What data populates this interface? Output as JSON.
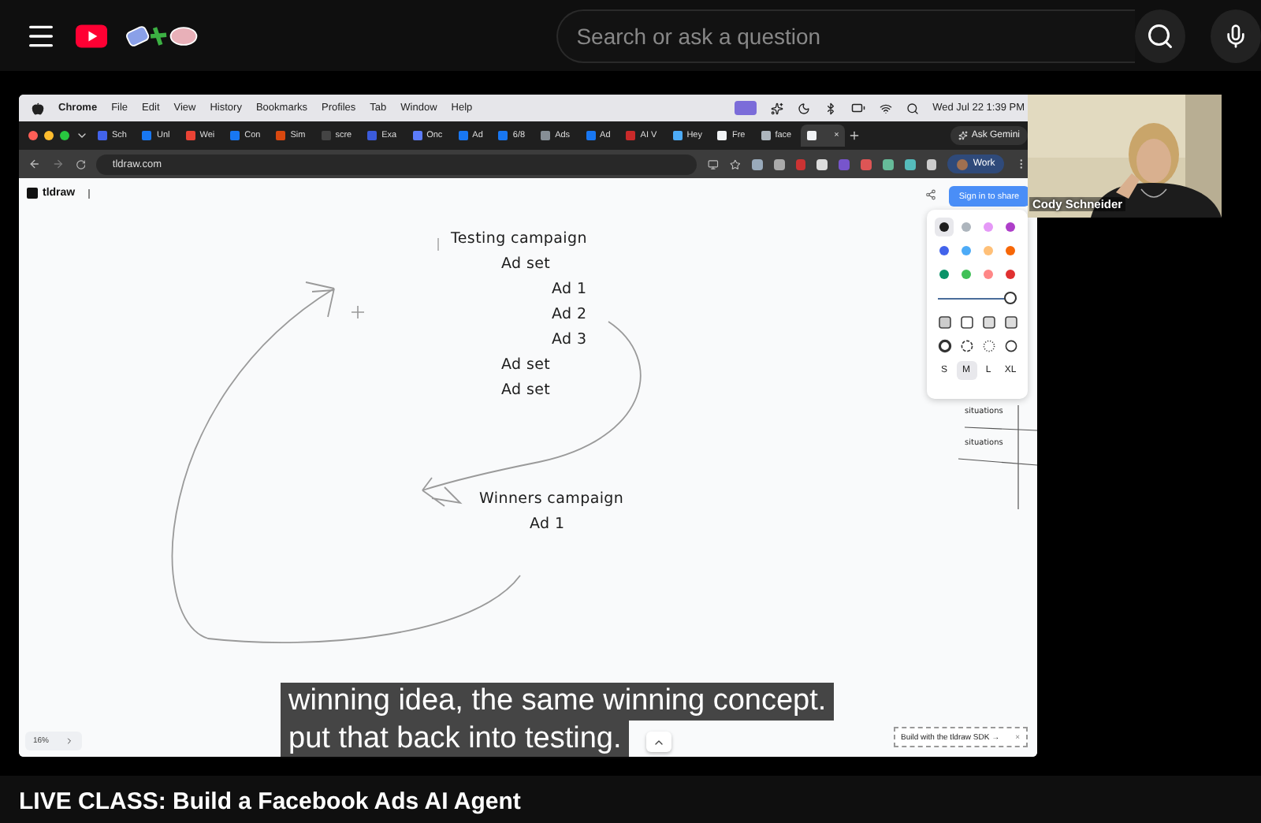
{
  "header": {
    "search": {
      "placeholder": "Search or ask a question"
    }
  },
  "screen": {
    "menu_bar": {
      "app": "Chrome",
      "items": [
        "File",
        "Edit",
        "View",
        "History",
        "Bookmarks",
        "Profiles",
        "Tab",
        "Window",
        "Help"
      ],
      "clock": "Wed Jul 22  1:39 PM"
    },
    "tabs": [
      {
        "label": "Sch",
        "color": "#4263eb",
        "selected": false
      },
      {
        "label": "Unl",
        "color": "#1877f2",
        "selected": false
      },
      {
        "label": "Wei",
        "color": "#ea4335",
        "selected": false
      },
      {
        "label": "Con",
        "color": "#1877f2",
        "selected": false
      },
      {
        "label": "Sim",
        "color": "#d9480f",
        "selected": false
      },
      {
        "label": "scre",
        "color": "#444444",
        "selected": false
      },
      {
        "label": "Exa",
        "color": "#3b5bdb",
        "selected": false
      },
      {
        "label": "Onc",
        "color": "#5c7cfa",
        "selected": false
      },
      {
        "label": "Ad",
        "color": "#1877f2",
        "selected": false
      },
      {
        "label": "6/8",
        "color": "#1877f2",
        "selected": false
      },
      {
        "label": "Ads",
        "color": "#868e96",
        "selected": false
      },
      {
        "label": "Ad",
        "color": "#1877f2",
        "selected": false
      },
      {
        "label": "AI V",
        "color": "#c92a2a",
        "selected": false
      },
      {
        "label": "Hey",
        "color": "#4dabf7",
        "selected": false
      },
      {
        "label": "Fre",
        "color": "#f1f3f5",
        "selected": false
      },
      {
        "label": "face",
        "color": "#adb5bd",
        "selected": false
      },
      {
        "color": "#f1f3f5",
        "selected": true,
        "close": "×"
      }
    ],
    "ask_gemini": "Ask Gemini",
    "address": "tldraw.com",
    "profile": "Work",
    "canvas": {
      "logo": "tldraw",
      "sign_in": "Sign in to share",
      "colors": [
        {
          "color": "#1d1d1d",
          "selected": true
        },
        {
          "color": "#adb5bd",
          "selected": false
        },
        {
          "color": "#e599f7",
          "selected": false
        },
        {
          "color": "#ae3ec9",
          "selected": false
        },
        {
          "color": "#4263eb",
          "selected": false
        },
        {
          "color": "#4dabf7",
          "selected": false
        },
        {
          "color": "#ffc078",
          "selected": false
        },
        {
          "color": "#f76707",
          "selected": false
        },
        {
          "color": "#099268",
          "selected": false
        },
        {
          "color": "#40c057",
          "selected": false
        },
        {
          "color": "#ff8787",
          "selected": false
        },
        {
          "color": "#e03131",
          "selected": false
        }
      ],
      "opacity": {
        "level": 1
      },
      "sizes": [
        {
          "label": "S",
          "selected": false
        },
        {
          "label": "M",
          "selected": true
        },
        {
          "label": "L",
          "selected": false
        },
        {
          "label": "XL",
          "selected": false
        }
      ],
      "outline": [
        {
          "text": "Testing campaign",
          "children": [
            {
              "text": "Ad set",
              "children": [
                {
                  "text": "Ad 1"
                },
                {
                  "text": "Ad 2"
                },
                {
                  "text": "Ad 3"
                }
              ]
            },
            {
              "text": "Ad set"
            },
            {
              "text": "Ad set"
            }
          ]
        },
        {
          "text": "Winners campaign",
          "children": [
            {
              "text": "Ad 1"
            }
          ]
        }
      ],
      "side_labels": [
        "situations",
        "situations"
      ],
      "zoom": "16%",
      "sdk_banner": "Build with the tldraw SDK →",
      "sdk_close": "×"
    }
  },
  "webcam": {
    "name": "Cody Schneider"
  },
  "captions": [
    "winning idea, the same winning concept.",
    "put that back into testing."
  ],
  "video_title": "LIVE CLASS: Build a Facebook Ads AI Agent"
}
